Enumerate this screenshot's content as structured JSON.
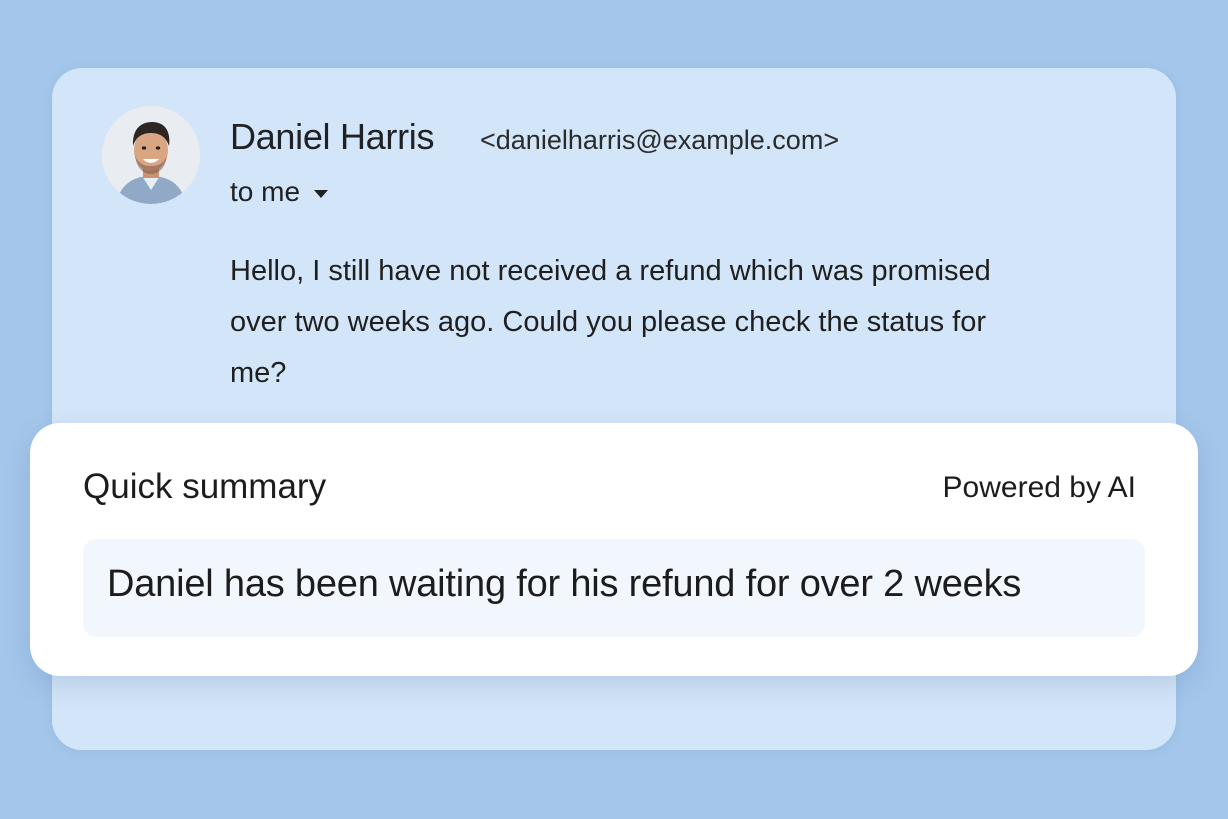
{
  "email": {
    "sender_name": "Daniel Harris",
    "sender_email": "<danielharris@example.com>",
    "recipient_label": "to me",
    "body": "Hello, I still have not received a refund which was promised over two weeks ago. Could you please check the status for me?",
    "avatar_icon": "person-photo"
  },
  "summary": {
    "title": "Quick summary",
    "powered_by": "Powered by AI",
    "text": "Daniel has been waiting for his refund for over 2 weeks"
  },
  "colors": {
    "background": "#a3c6ea",
    "email_card": "#d3e5f8",
    "summary_card": "#ffffff",
    "summary_box": "#f2f6fd"
  }
}
